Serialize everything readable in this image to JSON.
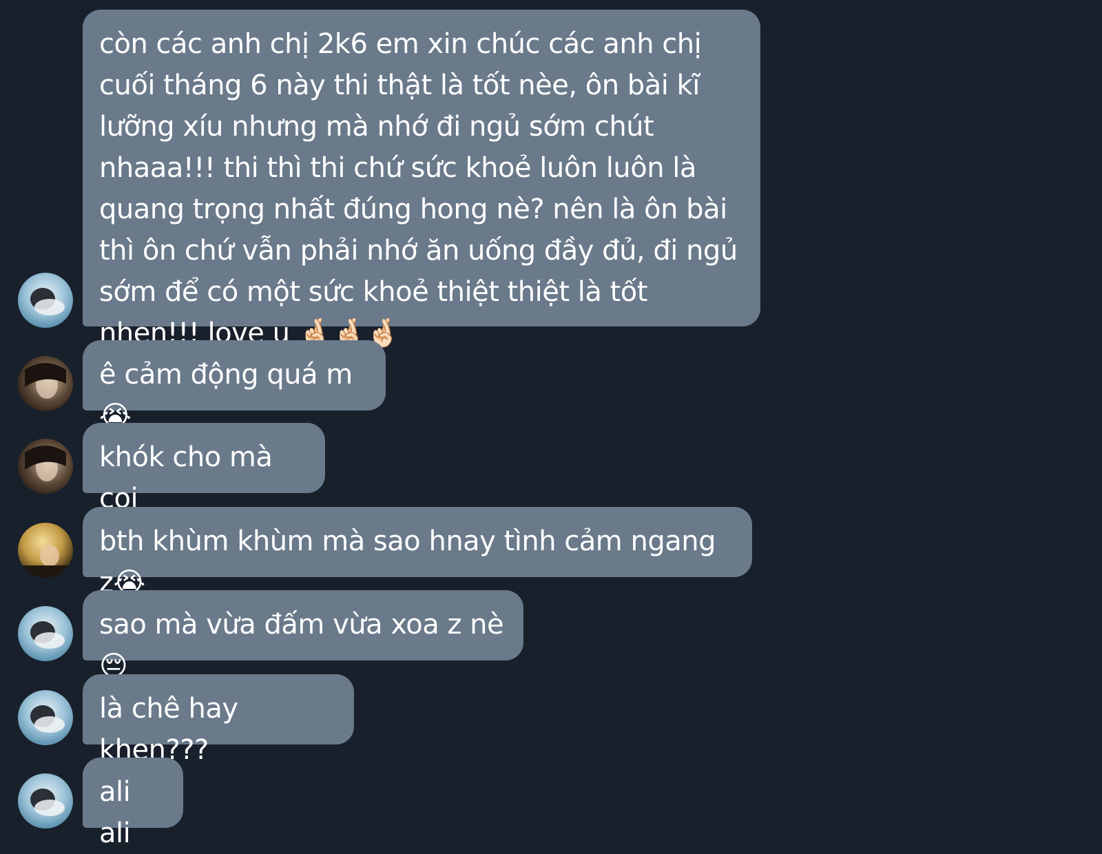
{
  "messages": [
    {
      "text": "còn các anh chị 2k6 em xin chúc các anh chị cuối tháng 6 này thi thật là tốt nèe, ôn bài kĩ lưỡng xíu nhưng mà nhớ đi ngủ sớm chút nhaaa!!! thi thì thi chứ sức khoẻ luôn luôn là quang trọng nhất đúng hong nè? nên là ôn bài thì ôn chứ vẫn phải nhớ ăn uống đầy đủ, đi ngủ sớm để có một sức khoẻ thiệt thiệt là tốt nhen!!! love u 🤞🏻🤞🏻🤞🏻",
      "avatar": "avatar-blue-photo"
    },
    {
      "text": "ê cảm động quá m😭",
      "avatar": "avatar-dark-photo"
    },
    {
      "text": "khók cho mà coi",
      "avatar": "avatar-dark-photo"
    },
    {
      "text": "bth khùm khùm mà sao hnay tình cảm ngang z😭",
      "avatar": "avatar-blonde-photo"
    },
    {
      "text": "sao mà vừa đấm vừa xoa z nè😔",
      "avatar": "avatar-blue-photo"
    },
    {
      "text": "là chê hay khen???",
      "avatar": "avatar-blue-photo"
    },
    {
      "text": "ali ali",
      "avatar": "avatar-blue-photo"
    }
  ],
  "colors": {
    "background": "#18202b",
    "bubble": "#6a7a8b",
    "text": "#ffffff"
  }
}
